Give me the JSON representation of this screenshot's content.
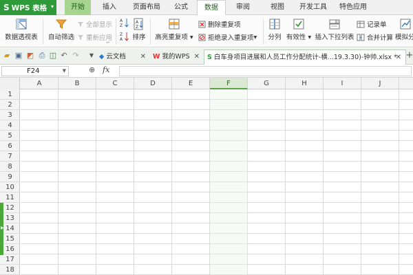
{
  "app": {
    "logo_label": "WPS 表格"
  },
  "ribbon_tabs": [
    {
      "label": "开始"
    },
    {
      "label": "插入"
    },
    {
      "label": "页面布局"
    },
    {
      "label": "公式"
    },
    {
      "label": "数据"
    },
    {
      "label": "审阅"
    },
    {
      "label": "视图"
    },
    {
      "label": "开发工具"
    },
    {
      "label": "特色应用"
    }
  ],
  "active_tab": "数据",
  "ribbon": {
    "pivot": "数据透视表",
    "autofilter": "自动筛选",
    "show_all": "全部显示",
    "reapply": "重新应用",
    "sort": "排序",
    "highlight_dup": "高亮重复项",
    "delete_dup": "删除重复项",
    "reject_dup": "拒绝录入重复项",
    "split": "分列",
    "validity": "有效性",
    "dropdown": "插入下拉列表",
    "records": "记录单",
    "merge_calc": "合并计算",
    "simulate": "模拟分"
  },
  "doc_tabs": [
    {
      "label": "云文档"
    },
    {
      "label": "我的WPS"
    },
    {
      "label": "白车身项目进展和人员工作分配统计-横...19.3.30)-钟帅.xlsx *"
    }
  ],
  "formula_bar": {
    "cell_ref": "F24",
    "fx_label": "fx",
    "formula": ""
  },
  "columns": [
    "A",
    "B",
    "C",
    "D",
    "E",
    "F",
    "G",
    "H",
    "I",
    "J"
  ],
  "selected_column": "F",
  "rows": [
    "1",
    "2",
    "3",
    "4",
    "5",
    "6",
    "7",
    "8",
    "9",
    "10",
    "11",
    "12",
    "13",
    "14",
    "15",
    "16",
    "17",
    "18",
    "19"
  ],
  "colors": {
    "brand_green": "#2f9a3a",
    "selection_green": "#5aa243",
    "tab_highlight": "#a7d48f"
  }
}
